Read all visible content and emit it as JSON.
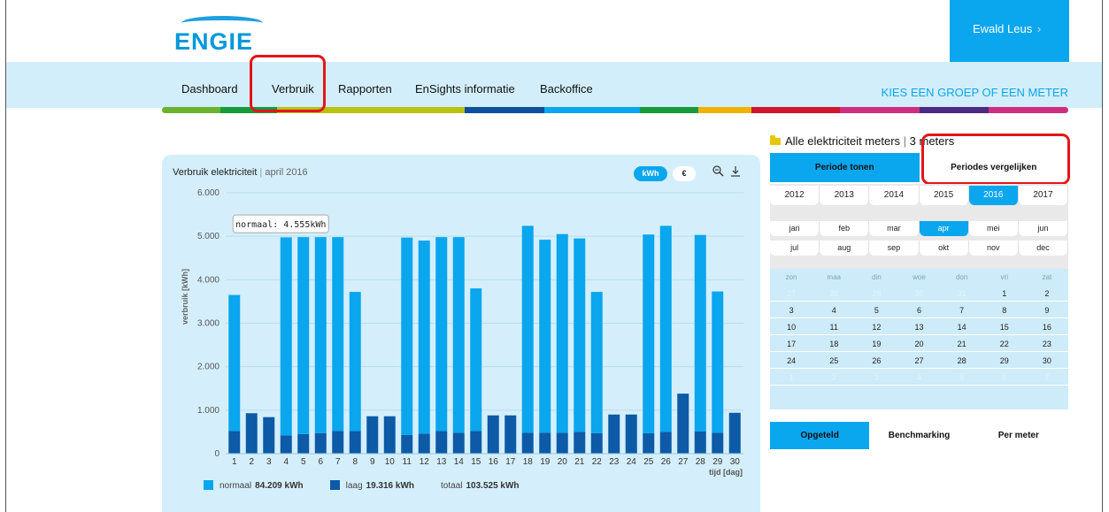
{
  "header": {
    "logo_text": "ENGIE",
    "user_name": "Ewald Leus",
    "user_caret": "›"
  },
  "nav": {
    "items": [
      {
        "label": "Dashboard"
      },
      {
        "label": "Verbruik"
      },
      {
        "label": "Rapporten"
      },
      {
        "label": "EnSights informatie"
      },
      {
        "label": "Backoffice"
      }
    ],
    "group_link": "KIES EEN GROEP OF EEN METER"
  },
  "accent_colors": [
    "#69b32e",
    "#169b3b",
    "#b9c20e",
    "#0d4f9e",
    "#0aa6ee",
    "#169b3b",
    "#f0b200",
    "#d2152d",
    "#cf2e7e",
    "#4b2984",
    "#cf2e7e"
  ],
  "chart_panel": {
    "title": "Verbruik elektriciteit",
    "title_sep": " | ",
    "period": "april 2016",
    "unit_kwh": "kWh",
    "unit_eur": "€",
    "zoom_icon": "zoom-out-icon",
    "download_icon": "download-icon",
    "tooltip": "normaal: 4.555kWh",
    "legend": [
      {
        "label": "normaal",
        "value": "84.209 kWh",
        "color": "#0aa6ee"
      },
      {
        "label": "laag",
        "value": "19.316 kWh",
        "color": "#0d5aa7"
      },
      {
        "label": "totaal",
        "value": "103.525 kWh"
      }
    ]
  },
  "chart_data": {
    "type": "bar",
    "stacked": true,
    "title": "",
    "xlabel": "tijd [dag]",
    "ylabel": "verbruik [kWh]",
    "ylim": [
      0,
      6000
    ],
    "yticks": [
      "0",
      "1.000",
      "2.000",
      "3.000",
      "4.000",
      "5.000",
      "6.000"
    ],
    "categories": [
      "1",
      "2",
      "3",
      "4",
      "5",
      "6",
      "7",
      "8",
      "9",
      "10",
      "11",
      "12",
      "13",
      "14",
      "15",
      "16",
      "17",
      "18",
      "19",
      "20",
      "21",
      "22",
      "23",
      "24",
      "25",
      "26",
      "27",
      "28",
      "29",
      "30"
    ],
    "series": [
      {
        "name": "laag",
        "color": "#0d5aa7",
        "values": [
          520,
          930,
          840,
          420,
          450,
          470,
          520,
          520,
          860,
          860,
          430,
          460,
          520,
          480,
          520,
          880,
          880,
          480,
          480,
          480,
          500,
          470,
          900,
          900,
          470,
          500,
          1380,
          510,
          480,
          940
        ]
      },
      {
        "name": "normaal",
        "color": "#0aa6ee",
        "values": [
          3130,
          0,
          0,
          4555,
          4530,
          4510,
          4460,
          3200,
          0,
          0,
          4540,
          4440,
          4460,
          4500,
          3280,
          0,
          0,
          4760,
          4440,
          4570,
          4450,
          3250,
          0,
          0,
          4570,
          4740,
          0,
          4520,
          3250,
          0
        ]
      }
    ]
  },
  "meters": {
    "title": "Alle elektriciteit meters",
    "sep": " | ",
    "count": "3 meters"
  },
  "period_tabs": {
    "show": "Periode tonen",
    "compare": "Periodes vergelijken"
  },
  "calendar": {
    "years": [
      "2012",
      "2013",
      "2014",
      "2015",
      "2016",
      "2017"
    ],
    "selected_year": "2016",
    "months_row1": [
      "jan",
      "feb",
      "mar",
      "apr",
      "mei",
      "jun"
    ],
    "months_row2": [
      "jul",
      "aug",
      "sep",
      "okt",
      "nov",
      "dec"
    ],
    "selected_month": "apr",
    "weekdays": [
      "zon",
      "maa",
      "din",
      "woe",
      "don",
      "vri",
      "zat"
    ],
    "weeks": [
      [
        "27",
        "28",
        "29",
        "30",
        "31",
        "1",
        "2"
      ],
      [
        "3",
        "4",
        "5",
        "6",
        "7",
        "8",
        "9"
      ],
      [
        "10",
        "11",
        "12",
        "13",
        "14",
        "15",
        "16"
      ],
      [
        "17",
        "18",
        "19",
        "20",
        "21",
        "22",
        "23"
      ],
      [
        "24",
        "25",
        "26",
        "27",
        "28",
        "29",
        "30"
      ],
      [
        "1",
        "2",
        "3",
        "4",
        "5",
        "6",
        "7"
      ]
    ]
  },
  "bottom_tabs": {
    "opgeteld": "Opgeteld",
    "benchmarking": "Benchmarking",
    "per_meter": "Per meter"
  }
}
